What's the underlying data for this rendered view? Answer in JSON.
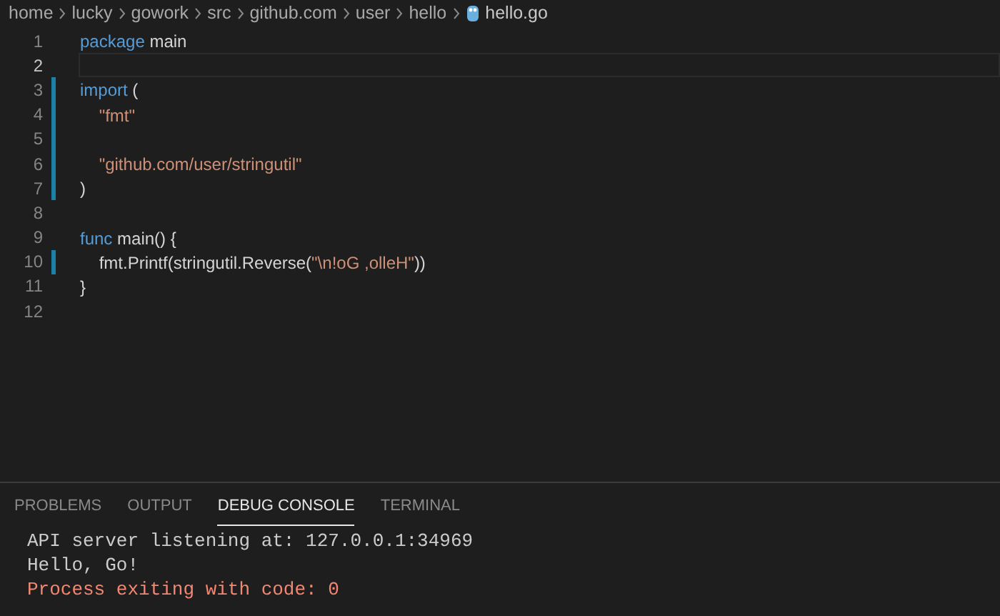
{
  "breadcrumbs": [
    {
      "label": "home",
      "kind": "folder"
    },
    {
      "label": "lucky",
      "kind": "folder"
    },
    {
      "label": "gowork",
      "kind": "folder"
    },
    {
      "label": "src",
      "kind": "folder"
    },
    {
      "label": "github.com",
      "kind": "folder"
    },
    {
      "label": "user",
      "kind": "folder"
    },
    {
      "label": "hello",
      "kind": "folder"
    },
    {
      "label": "hello.go",
      "kind": "file"
    }
  ],
  "editor": {
    "lines": [
      {
        "number": "1",
        "current": false,
        "modified": false,
        "tokens": [
          {
            "kind": "keyword",
            "text": "package"
          },
          {
            "kind": "plain",
            "text": " main"
          }
        ]
      },
      {
        "number": "2",
        "current": true,
        "modified": false
      },
      {
        "number": "3",
        "current": false,
        "modified": true,
        "tokens": [
          {
            "kind": "keyword",
            "text": "import"
          },
          {
            "kind": "plain",
            "text": " ("
          }
        ]
      },
      {
        "number": "4",
        "current": false,
        "modified": true,
        "tokens": [
          {
            "kind": "string",
            "text": "    \"fmt\""
          }
        ]
      },
      {
        "number": "5",
        "current": false,
        "modified": true
      },
      {
        "number": "6",
        "current": false,
        "modified": true,
        "tokens": [
          {
            "kind": "string",
            "text": "    \"github.com/user/stringutil\""
          }
        ]
      },
      {
        "number": "7",
        "current": false,
        "modified": true,
        "tokens": [
          {
            "kind": "plain",
            "text": ")"
          }
        ]
      },
      {
        "number": "8",
        "current": false,
        "modified": false
      },
      {
        "number": "9",
        "current": false,
        "modified": false,
        "tokens": [
          {
            "kind": "keyword",
            "text": "func"
          },
          {
            "kind": "plain",
            "text": " main() {"
          }
        ]
      },
      {
        "number": "10",
        "current": false,
        "modified": true,
        "tokens": [
          {
            "kind": "plain",
            "text": "    fmt.Printf(stringutil.Reverse("
          },
          {
            "kind": "string",
            "text": "\"\\n!oG ,olleH\""
          },
          {
            "kind": "plain",
            "text": "))"
          }
        ]
      },
      {
        "number": "11",
        "current": false,
        "modified": false,
        "tokens": [
          {
            "kind": "plain",
            "text": "}"
          }
        ]
      },
      {
        "number": "12",
        "current": false,
        "modified": false
      }
    ]
  },
  "panel": {
    "tabs": [
      {
        "label": "PROBLEMS",
        "selected": false
      },
      {
        "label": "OUTPUT",
        "selected": false
      },
      {
        "label": "DEBUG CONSOLE",
        "selected": true
      },
      {
        "label": "TERMINAL",
        "selected": false
      }
    ],
    "console": [
      {
        "kind": "info",
        "text": "API server listening at: 127.0.0.1:34969"
      },
      {
        "kind": "info",
        "text": "Hello, Go!"
      },
      {
        "kind": "error",
        "text": "Process exiting with code: 0"
      }
    ]
  }
}
